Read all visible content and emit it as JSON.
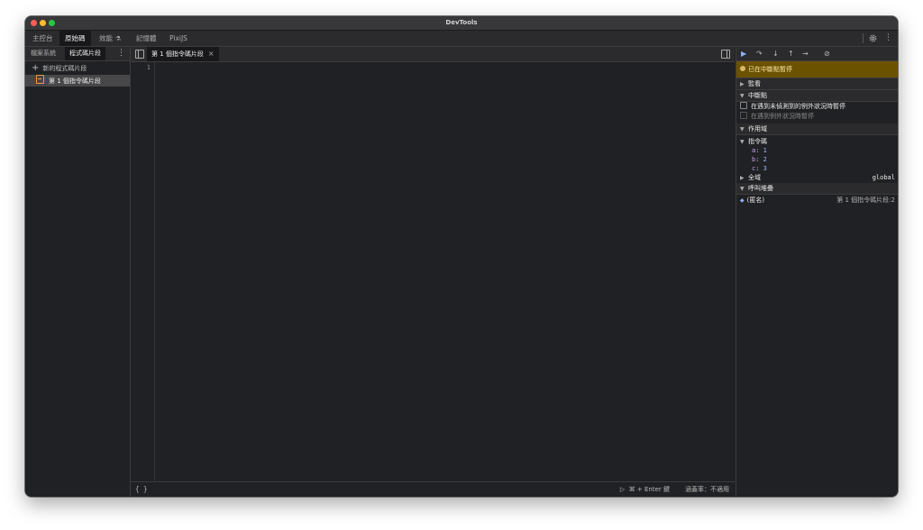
{
  "window": {
    "title": "DevTools"
  },
  "main_tabs": [
    "主控台",
    "原始碼",
    "效能",
    "記憶體",
    "PixiJS"
  ],
  "navigator": {
    "tabs": [
      "檔案系統",
      "程式碼片段"
    ],
    "new_snippet": "新的程式碼片段",
    "snippet": "第 1 個指令碼片段"
  },
  "editor": {
    "tab_label": "第 1 個指令碼片段",
    "line_number": "1",
    "pretty_print": "{ }",
    "run_hint": "⌘ + Enter 鍵",
    "coverage": "涵蓋率：不適用"
  },
  "debugger": {
    "paused_message": "已在中斷點暫停",
    "sections": {
      "watch": "監看",
      "breakpoints": "中斷點",
      "scope": "作用域",
      "call_stack": "呼叫堆疊"
    },
    "breakpoint_options": [
      {
        "label": "在遇到未偵測到的例外狀況時暫停",
        "enabled": true
      },
      {
        "label": "在遇到例外狀況時暫停",
        "enabled": false
      }
    ],
    "scope": {
      "local_label": "指令碼",
      "variables": [
        {
          "name": "a",
          "value": "1"
        },
        {
          "name": "b",
          "value": "2"
        },
        {
          "name": "c",
          "value": "3"
        }
      ],
      "global_label": "全域",
      "global_value": "global"
    },
    "call_stack": [
      {
        "name": "(匿名)",
        "location": "第 1 個指令碼片段:2"
      }
    ]
  },
  "colors": {
    "accent": "#8ab4f8",
    "paused_banner_bg": "#6b5200",
    "snippet_icon": "#e89a3c"
  }
}
